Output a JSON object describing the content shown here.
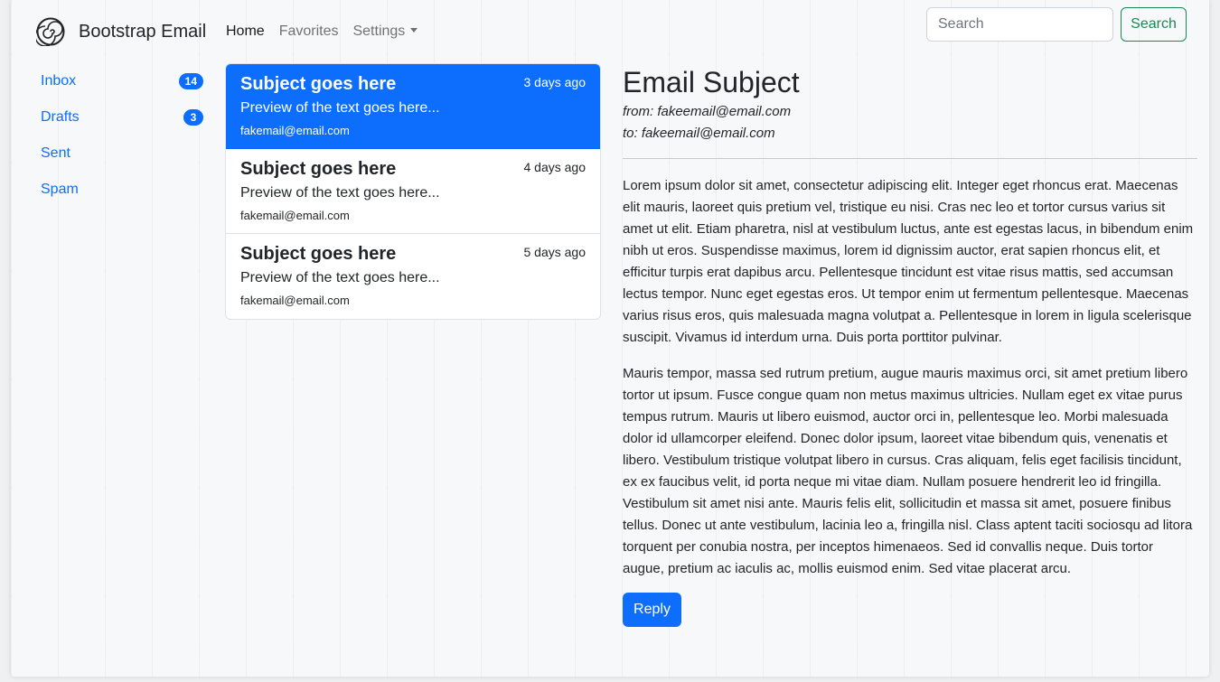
{
  "brand": {
    "name": "Bootstrap Email",
    "icon": "spiral-logo-icon"
  },
  "nav": [
    {
      "label": "Home",
      "active": true
    },
    {
      "label": "Favorites",
      "active": false
    },
    {
      "label": "Settings",
      "active": false,
      "dropdown": true
    }
  ],
  "search": {
    "placeholder": "Search",
    "button_label": "Search"
  },
  "sidebar": {
    "items": [
      {
        "label": "Inbox",
        "badge": "14"
      },
      {
        "label": "Drafts",
        "badge": "3"
      },
      {
        "label": "Sent"
      },
      {
        "label": "Spam"
      }
    ]
  },
  "emails": [
    {
      "subject": "Subject goes here",
      "date": "3 days ago",
      "preview": "Preview of the text goes here...",
      "from": "fakemail@email.com",
      "active": true
    },
    {
      "subject": "Subject goes here",
      "date": "4 days ago",
      "preview": "Preview of the text goes here...",
      "from": "fakemail@email.com"
    },
    {
      "subject": "Subject goes here",
      "date": "5 days ago",
      "preview": "Preview of the text goes here...",
      "from": "fakemail@email.com"
    }
  ],
  "reader": {
    "subject": "Email Subject",
    "from": "from: fakeemail@email.com",
    "to": "to: fakeemail@email.com",
    "paragraphs": [
      "Lorem ipsum dolor sit amet, consectetur adipiscing elit. Integer eget rhoncus erat. Maecenas elit mauris, laoreet quis pretium vel, tristique eu nisi. Cras nec leo et tortor cursus varius sit amet ut elit. Etiam pharetra, nisl at vestibulum luctus, ante est egestas lacus, in bibendum enim nibh ut eros. Suspendisse maximus, lorem id dignissim auctor, erat sapien rhoncus elit, et efficitur turpis erat dapibus arcu. Pellentesque tincidunt est vitae risus mattis, sed accumsan lectus tempor. Nunc eget egestas eros. Ut tempor enim ut fermentum pellentesque. Maecenas varius risus eros, quis malesuada magna volutpat a. Pellentesque in lorem in ligula scelerisque suscipit. Vivamus id interdum urna. Duis porta porttitor pulvinar.",
      "Mauris tempor, massa sed rutrum pretium, augue mauris maximus orci, sit amet pretium libero tortor ut ipsum. Fusce congue quam non metus maximus ultricies. Nullam eget ex vitae purus tempus rutrum. Mauris ut libero euismod, auctor orci in, pellentesque leo. Morbi malesuada dolor id ullamcorper eleifend. Donec dolor ipsum, laoreet vitae bibendum quis, venenatis et libero. Vestibulum tristique volutpat libero in cursus. Cras aliquam, felis eget facilisis tincidunt, ex ex faucibus velit, id porta neque mi vitae diam. Nullam posuere hendrerit leo id fringilla. Vestibulum sit amet nisi ante. Mauris felis elit, sollicitudin et massa sit amet, posuere finibus tellus. Donec ut ante vestibulum, lacinia leo a, fringilla nisl. Class aptent taciti sociosqu ad litora torquent per conubia nostra, per inceptos himenaeos. Sed id convallis neque. Duis tortor augue, pretium ac iaculis ac, mollis euismod enim. Sed vitae placerat arcu."
    ],
    "reply_label": "Reply"
  },
  "colors": {
    "primary": "#0d6efd",
    "success": "#198754",
    "text": "#212529",
    "background": "#f7f8f9"
  }
}
